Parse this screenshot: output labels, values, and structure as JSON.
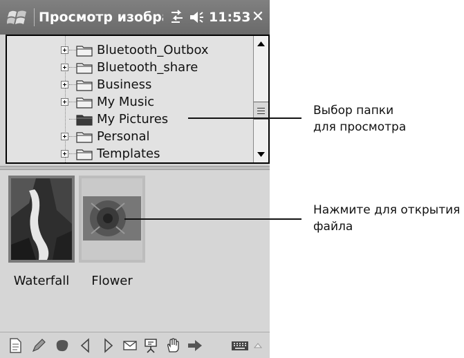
{
  "window": {
    "title": "Просмотр изобра:",
    "clock": "11:53",
    "close_label": "✕"
  },
  "tree": {
    "items": [
      {
        "label": "Bluetooth_Outbox",
        "expandable": true,
        "selected": false
      },
      {
        "label": "Bluetooth_share",
        "expandable": true,
        "selected": false
      },
      {
        "label": "Business",
        "expandable": true,
        "selected": false
      },
      {
        "label": "My Music",
        "expandable": true,
        "selected": false
      },
      {
        "label": "My Pictures",
        "expandable": false,
        "selected": true
      },
      {
        "label": "Personal",
        "expandable": true,
        "selected": false
      },
      {
        "label": "Templates",
        "expandable": true,
        "selected": false
      }
    ]
  },
  "thumbnails": [
    {
      "label": "Waterfall",
      "icon": "waterfall-photo"
    },
    {
      "label": "Flower",
      "icon": "flower-photo"
    }
  ],
  "toolbar": {
    "icons": [
      "document-icon",
      "pen-icon",
      "blob-icon",
      "back-arrow-icon",
      "forward-arrow-icon",
      "envelope-icon",
      "slideshow-icon",
      "hand-icon",
      "right-arrow-icon",
      "keyboard-icon",
      "input-menu-arrow-icon"
    ]
  },
  "callouts": {
    "folder": "Выбор папки\nдля просмотра",
    "open": "Нажмите для открытия\nфайла"
  }
}
